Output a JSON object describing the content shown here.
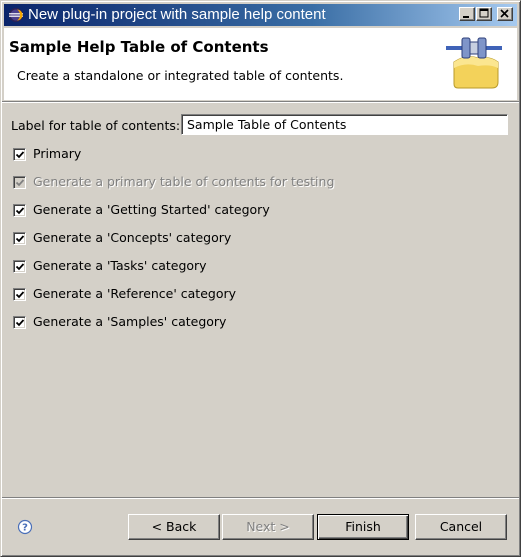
{
  "window": {
    "title": "New plug-in project with sample help content",
    "icon": "eclipse-icon"
  },
  "header": {
    "title": "Sample Help Table of Contents",
    "description": "Create a standalone or integrated table of contents.",
    "image": "plug-in-wizard-banner-icon"
  },
  "form": {
    "label": "Label for table of contents:",
    "value": "Sample Table of Contents"
  },
  "checkboxes": [
    {
      "label": "Primary",
      "checked": true,
      "enabled": true
    },
    {
      "label": "Generate a primary table of contents for testing",
      "checked": true,
      "enabled": false
    },
    {
      "label": "Generate a 'Getting Started' category",
      "checked": true,
      "enabled": true
    },
    {
      "label": "Generate a 'Concepts' category",
      "checked": true,
      "enabled": true
    },
    {
      "label": "Generate a 'Tasks' category",
      "checked": true,
      "enabled": true
    },
    {
      "label": "Generate a 'Reference' category",
      "checked": true,
      "enabled": true
    },
    {
      "label": "Generate a 'Samples' category",
      "checked": true,
      "enabled": true
    }
  ],
  "buttons": {
    "back": "< Back",
    "next": "Next >",
    "finish": "Finish",
    "cancel": "Cancel"
  },
  "icons": {
    "help": "help-icon"
  },
  "colors": {
    "titlebar_start": "#0a246a",
    "titlebar_end": "#a6caf0",
    "dialog_background": "#d4d0c8",
    "disabled_text": "#808080"
  }
}
